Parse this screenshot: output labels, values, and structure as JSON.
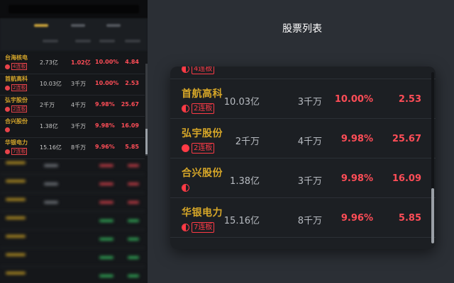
{
  "background_app": {
    "rows": [
      {
        "name": "台海核电",
        "badge": "4连板",
        "amount": "2.73亿",
        "volume": "1.02亿",
        "volume_red": true,
        "change": "10.00%",
        "price": "4.84"
      },
      {
        "name": "首航高科",
        "badge": "2连板",
        "amount": "10.03亿",
        "volume": "3千万",
        "volume_red": false,
        "change": "10.00%",
        "price": "2.53"
      },
      {
        "name": "弘宇股份",
        "badge": "2连板",
        "amount": "2千万",
        "volume": "4千万",
        "volume_red": false,
        "change": "9.98%",
        "price": "25.67"
      },
      {
        "name": "合兴股份",
        "badge": "",
        "amount": "1.38亿",
        "volume": "3千万",
        "volume_red": false,
        "change": "9.98%",
        "price": "16.09"
      },
      {
        "name": "华银电力",
        "badge": "7连板",
        "amount": "15.16亿",
        "volume": "8千万",
        "volume_red": false,
        "change": "9.96%",
        "price": "5.85"
      }
    ]
  },
  "panel": {
    "title": "股票列表"
  },
  "stock_list": {
    "rows": [
      {
        "name": "台海核电",
        "indicator": "half",
        "badge": "4连板",
        "amount": "2.73亿",
        "volume": "1.02亿",
        "volume_red": true,
        "change": "10.00%",
        "price": "4.84"
      },
      {
        "name": "首航高科",
        "indicator": "half",
        "badge": "2连板",
        "amount": "10.03亿",
        "volume": "3千万",
        "volume_red": false,
        "change": "10.00%",
        "price": "2.53"
      },
      {
        "name": "弘宇股份",
        "indicator": "full",
        "badge": "2连板",
        "amount": "2千万",
        "volume": "4千万",
        "volume_red": false,
        "change": "9.98%",
        "price": "25.67"
      },
      {
        "name": "合兴股份",
        "indicator": "half",
        "badge": "",
        "amount": "1.38亿",
        "volume": "3千万",
        "volume_red": false,
        "change": "9.98%",
        "price": "16.09"
      },
      {
        "name": "华银电力",
        "indicator": "half",
        "badge": "7连板",
        "amount": "15.16亿",
        "volume": "8千万",
        "volume_red": false,
        "change": "9.96%",
        "price": "5.85"
      }
    ]
  },
  "colors": {
    "stock_name": "#d7a728",
    "up_red": "#ff4d57",
    "neutral": "#b8bcc2",
    "card_bg": "#1c1f23",
    "page_bg": "#2a2e34"
  }
}
